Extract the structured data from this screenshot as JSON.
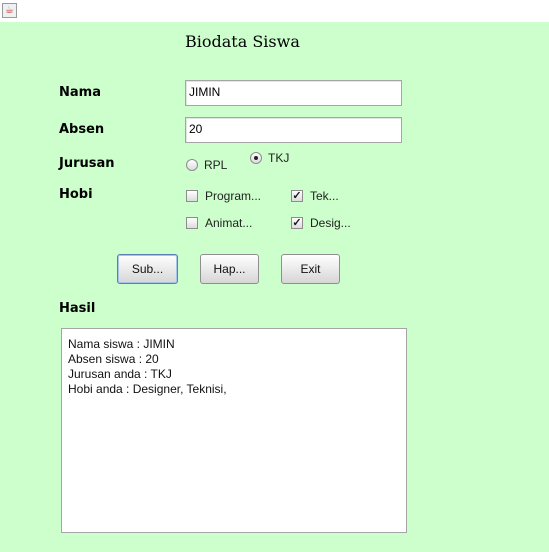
{
  "window": {
    "icon": "java-cup-icon"
  },
  "form": {
    "title": "Biodata Siswa",
    "labels": {
      "nama": "Nama",
      "absen": "Absen",
      "jurusan": "Jurusan",
      "hobi": "Hobi",
      "hasil": "Hasil"
    },
    "nama_value": "JIMIN",
    "absen_value": "20",
    "jurusan": {
      "options": [
        "RPL",
        "TKJ"
      ],
      "selected": "TKJ"
    },
    "hobi": [
      {
        "label": "Program...",
        "checked": false
      },
      {
        "label": "Tek...",
        "checked": true
      },
      {
        "label": "Animat...",
        "checked": false
      },
      {
        "label": "Desig...",
        "checked": true
      }
    ],
    "buttons": {
      "submit": "Sub...",
      "hapus": "Hap...",
      "exit": "Exit"
    },
    "result_lines": [
      "Nama siswa : JIMIN",
      "Absen siswa : 20",
      "Jurusan anda : TKJ",
      "Hobi anda : Designer, Teknisi,"
    ]
  }
}
